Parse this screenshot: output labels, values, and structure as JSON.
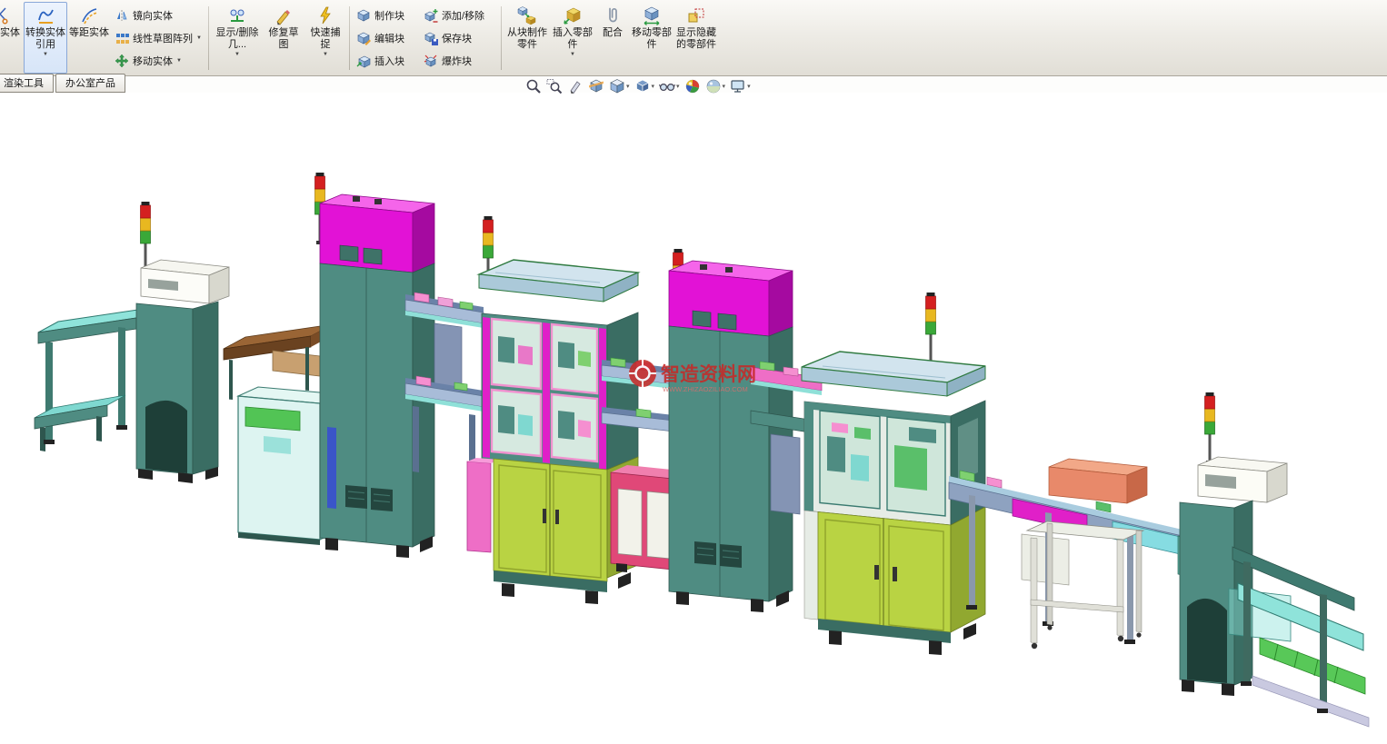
{
  "ribbon": {
    "buttons": {
      "trim_entities": "剪裁实体",
      "convert_entities": "转换实体引用",
      "offset_entities": "等距实体",
      "mirror_entities": "镜向实体",
      "linear_sketch_pattern": "线性草图阵列",
      "move_entities": "移动实体",
      "display_delete_relations": "显示/删除几...",
      "repair_sketch": "修复草图",
      "quick_snaps": "快速捕捉",
      "make_block": "制作块",
      "edit_block": "编辑块",
      "insert_block": "插入块",
      "add_remove": "添加/移除",
      "save_block": "保存块",
      "explode_block": "爆炸块",
      "make_part_from_block": "从块制作零件",
      "insert_components": "插入零部件",
      "mate": "配合",
      "move_component": "移动零部件",
      "show_hidden_components": "显示隐藏的零部件"
    }
  },
  "tabs": {
    "render_tools": "渲染工具",
    "office_products": "办公室产品"
  },
  "headsup_icons": [
    "zoom-fit",
    "zoom-area",
    "previous-view",
    "section-view",
    "view-orientation",
    "display-style",
    "hide-show-items",
    "edit-appearance",
    "apply-scene",
    "view-settings"
  ],
  "viewport": {
    "watermark_title": "智造资料网",
    "watermark_subtitle": "WWW.ZHIZAOZILIAO.COM"
  },
  "colors": {
    "machine_teal": "#4f8c82",
    "machine_teal_dark": "#3a6d63",
    "magenta_top": "#e212d6",
    "door_green": "#b9d343",
    "glass_blue": "#cfe2ec",
    "conveyor_cyan": "#8fe3da",
    "belt_green": "#58c858",
    "alarm_red": "#d42020",
    "alarm_yellow": "#e8b820",
    "alarm_green": "#3aa838",
    "watermark_red": "#c62a28"
  }
}
